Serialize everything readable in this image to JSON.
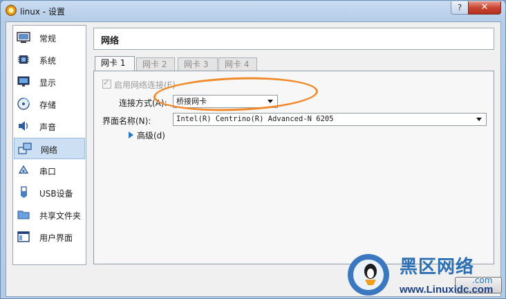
{
  "window": {
    "title": "linux - 设置",
    "help_glyph": "?",
    "close_glyph": "✕"
  },
  "sidebar": {
    "items": [
      {
        "label": "常规",
        "icon": "general-icon"
      },
      {
        "label": "系统",
        "icon": "system-chip-icon"
      },
      {
        "label": "显示",
        "icon": "display-monitor-icon"
      },
      {
        "label": "存储",
        "icon": "storage-disk-icon"
      },
      {
        "label": "声音",
        "icon": "speaker-icon"
      },
      {
        "label": "网络",
        "icon": "network-icon",
        "selected": true
      },
      {
        "label": "串口",
        "icon": "serial-port-icon"
      },
      {
        "label": "USB设备",
        "icon": "usb-icon"
      },
      {
        "label": "共享文件夹",
        "icon": "shared-folder-icon"
      },
      {
        "label": "用户界面",
        "icon": "user-interface-icon"
      }
    ]
  },
  "header": {
    "title": "网络"
  },
  "tabs": [
    {
      "label": "网卡 1",
      "active": true
    },
    {
      "label": "网卡 2"
    },
    {
      "label": "网卡 3"
    },
    {
      "label": "网卡 4"
    }
  ],
  "adapter": {
    "enable_label": "启用网络连接(E)",
    "attached_label": "连接方式(A):",
    "attached_value": "桥接网卡",
    "name_label": "界面名称(N):",
    "name_value": "Intel(R) Centrino(R) Advanced-N 6205",
    "advanced_label": "高级(d)"
  },
  "watermark": {
    "cn": "黑区网络",
    "url": "www.Linuxidc.com",
    "com": ".com"
  },
  "accent_color": "#f08a2a",
  "selection_color": "#cde0f3"
}
